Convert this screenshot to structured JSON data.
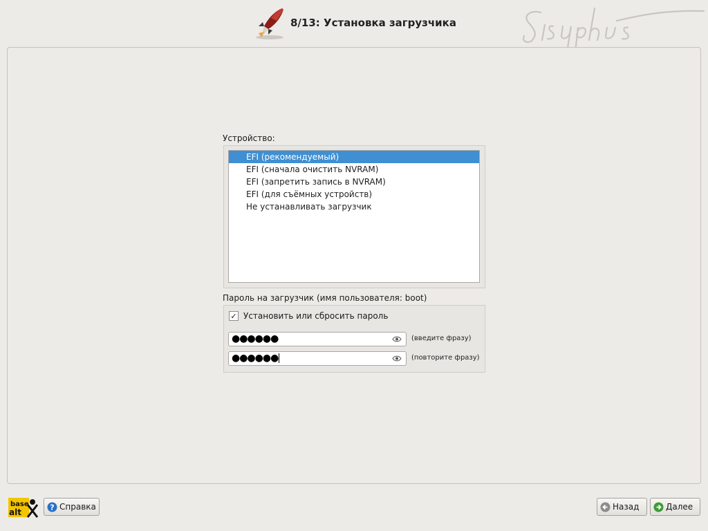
{
  "header": {
    "step_title": "8/13: Установка загрузчика",
    "logo_text": "Sisyphus"
  },
  "device": {
    "label": "Устройство:",
    "selected_index": 0,
    "items": [
      "EFI (рекомендуемый)",
      "EFI (сначала очистить NVRAM)",
      "EFI (запретить запись в NVRAM)",
      "EFI (для съёмных устройств)",
      "Не устанавливать загрузчик"
    ]
  },
  "password": {
    "label": "Пароль на загрузчик (имя пользователя: boot)",
    "checkbox_label": "Установить или сбросить пароль",
    "checkbox_checked": true,
    "field1_value": "●●●●●●",
    "field1_hint": "(введите фразу)",
    "field2_value": "●●●●●●",
    "field2_hint": "(повторите фразу)"
  },
  "footer": {
    "brand_logo_text": "base alt",
    "help_label": "Справка",
    "back_label": "Назад",
    "next_label": "Далее"
  },
  "colors": {
    "selection": "#3f8fd2",
    "background": "#edebe7"
  }
}
